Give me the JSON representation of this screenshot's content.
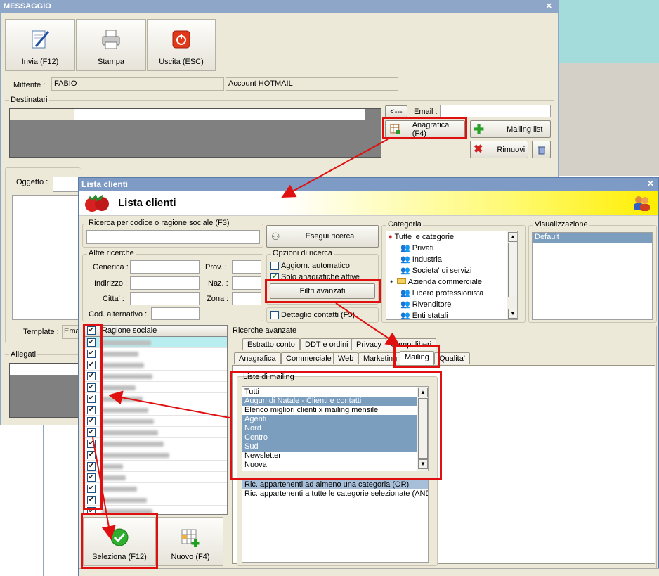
{
  "back_window": {
    "title": "MESSAGGIO",
    "toolbar": [
      {
        "label": "Invia (F12)",
        "icon": "pen-paper-icon"
      },
      {
        "label": "Stampa",
        "icon": "printer-icon"
      },
      {
        "label": "Uscita (ESC)",
        "icon": "power-icon"
      }
    ],
    "mittente_label": "Mittente :",
    "mittente_value": "FABIO",
    "account_value": "Account HOTMAIL",
    "destinatari_label": "Destinatari",
    "arrow_button": "<---",
    "email_label": "Email :",
    "anagrafica_button": "Anagrafica (F4)",
    "mailing_list_button": "Mailing list",
    "rimuovi_button": "Rimuovi",
    "oggetto_label": "Oggetto :",
    "template_label": "Template :",
    "template_value": "Emai",
    "allegati_label": "Allegati"
  },
  "front_window": {
    "title": "Lista clienti",
    "header_title": "Lista clienti",
    "ricerca_label": "Ricerca per codice o ragione sociale (F3)",
    "esegui_button": "Esegui ricerca",
    "altre_label": "Altre ricerche",
    "fields": {
      "generica": "Generica :",
      "indirizzo": "Indirizzo :",
      "citta": "Citta' :",
      "cod_alt": "Cod. alternativo :",
      "prov": "Prov. :",
      "naz": "Naz. :",
      "zona": "Zona :"
    },
    "opzioni_label": "Opzioni di ricerca",
    "aggiorn": "Aggiorn. automatico",
    "solo": "Solo anagrafiche attive",
    "filtri_button": "Filtri avanzati",
    "dettaglio": "Dettaglio contatti (F5)",
    "categoria_label": "Categoria",
    "categorie": [
      "Tutte le categorie",
      "Privati",
      "Industria",
      "Societa' di servizi",
      "Azienda commerciale",
      "Libero professionista",
      "Rivenditore",
      "Enti statali"
    ],
    "visualizzazione_label": "Visualizzazione",
    "visualizzazione_items": [
      "Default"
    ],
    "grid_header": "Ragione sociale",
    "ricerche_avanzate_label": "Ricerche avanzate",
    "tabs_row1": [
      "Estratto conto",
      "DDT e ordini",
      "Privacy",
      "Campi liberi"
    ],
    "tabs_row2": [
      "Anagrafica",
      "Commerciale",
      "Web",
      "Marketing",
      "Mailing",
      "Qualita'"
    ],
    "liste_label": "Liste di mailing",
    "liste": [
      {
        "name": "Tutti",
        "selected": false
      },
      {
        "name": "Auguri di Natale - Clienti e contatti",
        "selected": true
      },
      {
        "name": "Elenco migliori clienti x mailing mensile",
        "selected": false
      },
      {
        "name": "Agenti",
        "selected": true
      },
      {
        "name": "Nord",
        "selected": true
      },
      {
        "name": "Centro",
        "selected": true
      },
      {
        "name": "Sud",
        "selected": true
      },
      {
        "name": "Newsletter",
        "selected": false
      },
      {
        "name": "Nuova",
        "selected": false
      }
    ],
    "ric_options": [
      "Ric. appartenenti ad almeno una categoria (OR)",
      "Ric. appartenenti a tutte le categorie selezionate (AND)"
    ],
    "seleziona_button": "Seleziona (F12)",
    "nuovo_button": "Nuovo (F4)"
  },
  "colors": {
    "title_bar": "#8ea6c8",
    "title_bar_front": "#7d9bc4",
    "highlight": "#e01010",
    "selection": "#7b9ebf",
    "panel": "#ece9d8"
  }
}
